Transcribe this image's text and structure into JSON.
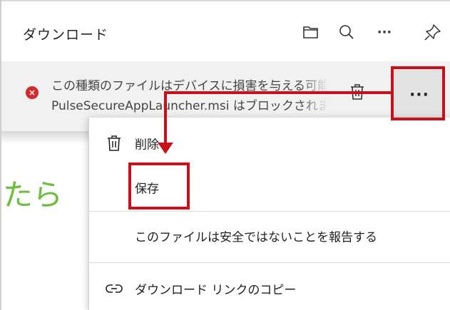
{
  "header": {
    "title": "ダウンロード",
    "icons": [
      "folder-icon",
      "search-icon",
      "more-options-icon",
      "pin-icon"
    ],
    "more_label": "···"
  },
  "download_item": {
    "status": "error",
    "status_icon": "error-x-icon",
    "warning_text": "この種類のファイルはデバイスに損害を与える可能性があります。",
    "file_text": "PulseSecureAppLauncher.msi はブロックされました。",
    "more_label": "···"
  },
  "background_page": {
    "text": "たら"
  },
  "context_menu": {
    "items": [
      {
        "label": "削除",
        "icon": "trash-icon"
      },
      {
        "label": "保存",
        "icon": ""
      },
      {
        "label": "このファイルは安全ではないことを報告する",
        "icon": ""
      },
      {
        "label": "ダウンロード リンクのコピー",
        "icon": "link-icon"
      }
    ]
  },
  "annotations": {
    "highlight_color": "#c8101a"
  }
}
